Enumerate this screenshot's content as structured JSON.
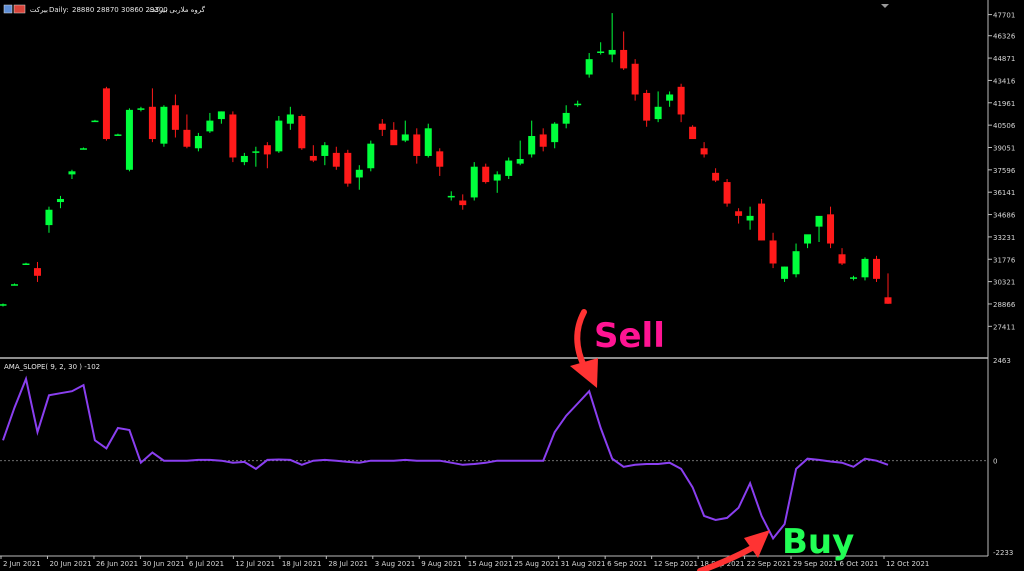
{
  "header": {
    "symbol_label": "بیرکت",
    "timeframe": "Daily:",
    "ohlc_text": "28880 28870 30860 29300",
    "indicator_title": "گروه ملاربی بیرکت"
  },
  "indicator": {
    "label": "AMA_SLOPE( 9, 2, 30 ) -102"
  },
  "annotations": {
    "sell": "Sell",
    "buy": "Buy"
  },
  "colors": {
    "background": "#000000",
    "bull": "#00ff3c",
    "bear": "#ff1a1a",
    "indicator_line": "#8a3ff0",
    "grid_border": "#bdbdbd",
    "sell_text": "#ff1493",
    "buy_text": "#22ff55",
    "arrow": "#ff3333"
  },
  "icons": {
    "window_icons": [
      "chart-window-icon",
      "flag-icon"
    ],
    "scroll_marker": "triangle-down-icon"
  },
  "chart_data": [
    {
      "type": "candlestick",
      "title": "",
      "xlabel": "",
      "ylabel": "",
      "ylim": [
        26000,
        48000
      ],
      "y_ticks": [
        "47701",
        "46326",
        "44871",
        "43416",
        "41961",
        "40506",
        "39051",
        "37596",
        "36141",
        "34686",
        "33231",
        "31776",
        "30321",
        "28866",
        "27411"
      ],
      "x_ticks": [
        "2 Jun 2021",
        "20 Jun 2021",
        "26 Jun 2021",
        "30 Jun 2021",
        "6 Jul 2021",
        "12 Jul 2021",
        "18 Jul 2021",
        "28 Jul 2021",
        "3 Aug 2021",
        "9 Aug 2021",
        "15 Aug 2021",
        "25 Aug 2021",
        "31 Aug 2021",
        "6 Sep 2021",
        "12 Sep 2021",
        "18 Sep 2021",
        "22 Sep 2021",
        "29 Sep 2021",
        "6 Oct 2021",
        "12 Oct 2021"
      ],
      "candles": [
        {
          "o": 28800,
          "h": 28900,
          "l": 28700,
          "c": 28850
        },
        {
          "o": 30150,
          "h": 30200,
          "l": 30100,
          "c": 30150
        },
        {
          "o": 31500,
          "h": 31550,
          "l": 31450,
          "c": 31500
        },
        {
          "o": 31200,
          "h": 31600,
          "l": 30300,
          "c": 30700
        },
        {
          "o": 34000,
          "h": 35200,
          "l": 33500,
          "c": 35000
        },
        {
          "o": 35500,
          "h": 35900,
          "l": 35100,
          "c": 35700
        },
        {
          "o": 37300,
          "h": 37600,
          "l": 37000,
          "c": 37500
        },
        {
          "o": 39000,
          "h": 39050,
          "l": 38950,
          "c": 39000
        },
        {
          "o": 40800,
          "h": 40850,
          "l": 40750,
          "c": 40800
        },
        {
          "o": 42900,
          "h": 43000,
          "l": 39500,
          "c": 39600
        },
        {
          "o": 39900,
          "h": 39950,
          "l": 39850,
          "c": 39900
        },
        {
          "o": 37600,
          "h": 41600,
          "l": 37500,
          "c": 41500
        },
        {
          "o": 41500,
          "h": 41700,
          "l": 41400,
          "c": 41600
        },
        {
          "o": 41700,
          "h": 42900,
          "l": 39400,
          "c": 39600
        },
        {
          "o": 39300,
          "h": 41800,
          "l": 39100,
          "c": 41700
        },
        {
          "o": 41800,
          "h": 42500,
          "l": 39700,
          "c": 40200
        },
        {
          "o": 40200,
          "h": 41200,
          "l": 39000,
          "c": 39100
        },
        {
          "o": 39000,
          "h": 40000,
          "l": 38800,
          "c": 39800
        },
        {
          "o": 40100,
          "h": 41300,
          "l": 40000,
          "c": 40800
        },
        {
          "o": 40900,
          "h": 41400,
          "l": 40600,
          "c": 41400
        },
        {
          "o": 41200,
          "h": 41400,
          "l": 38100,
          "c": 38400
        },
        {
          "o": 38100,
          "h": 38700,
          "l": 37900,
          "c": 38500
        },
        {
          "o": 38800,
          "h": 39100,
          "l": 37800,
          "c": 38800
        },
        {
          "o": 39200,
          "h": 39400,
          "l": 37700,
          "c": 38600
        },
        {
          "o": 38800,
          "h": 41100,
          "l": 38700,
          "c": 40800
        },
        {
          "o": 40600,
          "h": 41700,
          "l": 40200,
          "c": 41200
        },
        {
          "o": 41100,
          "h": 41200,
          "l": 38900,
          "c": 39000
        },
        {
          "o": 38500,
          "h": 39200,
          "l": 38100,
          "c": 38200
        },
        {
          "o": 38500,
          "h": 39400,
          "l": 37900,
          "c": 39200
        },
        {
          "o": 38700,
          "h": 39100,
          "l": 37600,
          "c": 37800
        },
        {
          "o": 38700,
          "h": 38900,
          "l": 36500,
          "c": 36700
        },
        {
          "o": 37100,
          "h": 37900,
          "l": 36300,
          "c": 37600
        },
        {
          "o": 37700,
          "h": 39500,
          "l": 37500,
          "c": 39300
        },
        {
          "o": 40600,
          "h": 40900,
          "l": 39800,
          "c": 40200
        },
        {
          "o": 40200,
          "h": 40700,
          "l": 39700,
          "c": 39200
        },
        {
          "o": 39500,
          "h": 40800,
          "l": 39400,
          "c": 39900
        },
        {
          "o": 39900,
          "h": 40300,
          "l": 38000,
          "c": 38500
        },
        {
          "o": 38500,
          "h": 40600,
          "l": 38400,
          "c": 40300
        },
        {
          "o": 38800,
          "h": 39000,
          "l": 37200,
          "c": 37800
        },
        {
          "o": 35800,
          "h": 36200,
          "l": 35600,
          "c": 35900
        },
        {
          "o": 35600,
          "h": 36000,
          "l": 35000,
          "c": 35300
        },
        {
          "o": 35800,
          "h": 38100,
          "l": 35600,
          "c": 37800
        },
        {
          "o": 37800,
          "h": 38000,
          "l": 36700,
          "c": 36800
        },
        {
          "o": 36900,
          "h": 37500,
          "l": 36100,
          "c": 37300
        },
        {
          "o": 37200,
          "h": 38400,
          "l": 37000,
          "c": 38200
        },
        {
          "o": 38000,
          "h": 39500,
          "l": 37900,
          "c": 38300
        },
        {
          "o": 38600,
          "h": 40800,
          "l": 38400,
          "c": 39800
        },
        {
          "o": 39900,
          "h": 40300,
          "l": 38800,
          "c": 39100
        },
        {
          "o": 39400,
          "h": 40700,
          "l": 39000,
          "c": 40600
        },
        {
          "o": 40600,
          "h": 41800,
          "l": 40300,
          "c": 41300
        },
        {
          "o": 41900,
          "h": 42100,
          "l": 41700,
          "c": 41900
        },
        {
          "o": 43800,
          "h": 45200,
          "l": 43600,
          "c": 44800
        },
        {
          "o": 45300,
          "h": 45900,
          "l": 45100,
          "c": 45300
        },
        {
          "o": 45100,
          "h": 47800,
          "l": 44600,
          "c": 45400
        },
        {
          "o": 45400,
          "h": 46600,
          "l": 44100,
          "c": 44200
        },
        {
          "o": 44500,
          "h": 44800,
          "l": 42100,
          "c": 42500
        },
        {
          "o": 42600,
          "h": 42800,
          "l": 40400,
          "c": 40800
        },
        {
          "o": 40900,
          "h": 42700,
          "l": 40700,
          "c": 41700
        },
        {
          "o": 42100,
          "h": 42700,
          "l": 41700,
          "c": 42500
        },
        {
          "o": 43000,
          "h": 43200,
          "l": 40700,
          "c": 41200
        },
        {
          "o": 40400,
          "h": 40500,
          "l": 39700,
          "c": 39600
        },
        {
          "o": 39000,
          "h": 39400,
          "l": 38400,
          "c": 38600
        },
        {
          "o": 37400,
          "h": 37700,
          "l": 36800,
          "c": 36900
        },
        {
          "o": 36800,
          "h": 37000,
          "l": 35200,
          "c": 35400
        },
        {
          "o": 34900,
          "h": 35100,
          "l": 34100,
          "c": 34600
        },
        {
          "o": 34300,
          "h": 35200,
          "l": 33700,
          "c": 34600
        },
        {
          "o": 35400,
          "h": 35700,
          "l": 33000,
          "c": 33000
        },
        {
          "o": 33000,
          "h": 33500,
          "l": 31200,
          "c": 31500
        },
        {
          "o": 30500,
          "h": 31300,
          "l": 30300,
          "c": 31300
        },
        {
          "o": 30800,
          "h": 32800,
          "l": 30600,
          "c": 32300
        },
        {
          "o": 32800,
          "h": 33200,
          "l": 32500,
          "c": 33400
        },
        {
          "o": 33900,
          "h": 34300,
          "l": 32900,
          "c": 34600
        },
        {
          "o": 34700,
          "h": 35200,
          "l": 32500,
          "c": 32800
        },
        {
          "o": 32100,
          "h": 32500,
          "l": 31400,
          "c": 31500
        },
        {
          "o": 30600,
          "h": 30700,
          "l": 30400,
          "c": 30600
        },
        {
          "o": 30600,
          "h": 31900,
          "l": 30400,
          "c": 31800
        },
        {
          "o": 31800,
          "h": 32000,
          "l": 30300,
          "c": 30500
        },
        {
          "o": 29300,
          "h": 30860,
          "l": 28870,
          "c": 28880
        }
      ]
    },
    {
      "type": "line",
      "title": "",
      "ylim": [
        -2233,
        2463
      ],
      "y_ticks": [
        "2463",
        "0",
        "-2233"
      ],
      "series": [
        {
          "name": "AMA_SLOPE( 9, 2, 30 ) -102",
          "values": [
            500,
            1300,
            2000,
            700,
            1600,
            1650,
            1700,
            1850,
            500,
            300,
            800,
            750,
            -50,
            200,
            0,
            0,
            0,
            20,
            20,
            0,
            -50,
            -30,
            -200,
            20,
            30,
            20,
            -100,
            0,
            20,
            0,
            -30,
            -50,
            0,
            0,
            0,
            20,
            0,
            0,
            0,
            -50,
            -100,
            -80,
            -50,
            0,
            0,
            0,
            0,
            0,
            700,
            1100,
            1400,
            1700,
            800,
            50,
            -150,
            -100,
            -80,
            -80,
            -50,
            -200,
            -650,
            -1350,
            -1450,
            -1400,
            -1150,
            -550,
            -1350,
            -1900,
            -1550,
            -200,
            50,
            20,
            -20,
            -50,
            -150,
            50,
            0,
            -100
          ],
          "color": "#8a3ff0"
        }
      ],
      "zero_line": true,
      "annotations": [
        {
          "text": "Sell",
          "at_index": 51
        },
        {
          "text": "Buy",
          "at_index": 66
        }
      ]
    }
  ]
}
